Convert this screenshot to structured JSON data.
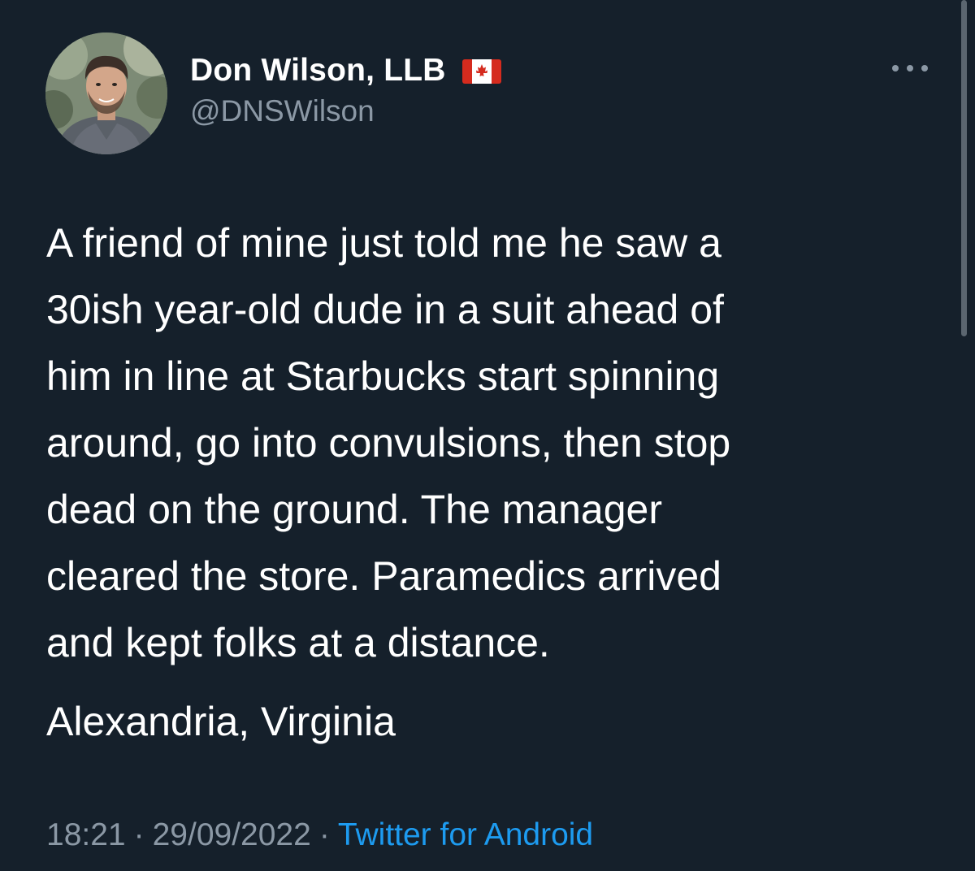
{
  "author": {
    "display_name": "Don Wilson, LLB",
    "handle": "@DNSWilson",
    "flag_icon": "canada-flag-icon",
    "avatar_icon": "profile-photo"
  },
  "menu": {
    "icon": "more-options-icon"
  },
  "tweet": {
    "lines": [
      "A friend of mine just told me he saw a",
      "30ish year-old dude in a suit ahead of",
      "him in line at Starbucks start spinning",
      "around, go into convulsions, then stop",
      "dead on the ground. The manager",
      "cleared the store. Paramedics arrived",
      "and kept folks at a distance."
    ],
    "location": "Alexandria, Virginia"
  },
  "meta": {
    "time": "18:21",
    "separator": "·",
    "date": "29/09/2022",
    "source": "Twitter for Android"
  },
  "colors": {
    "background": "#15202b",
    "primary_text": "#ffffff",
    "secondary_text": "#8b98a5",
    "link": "#1d9bf0",
    "flag_red": "#d52b1e"
  }
}
